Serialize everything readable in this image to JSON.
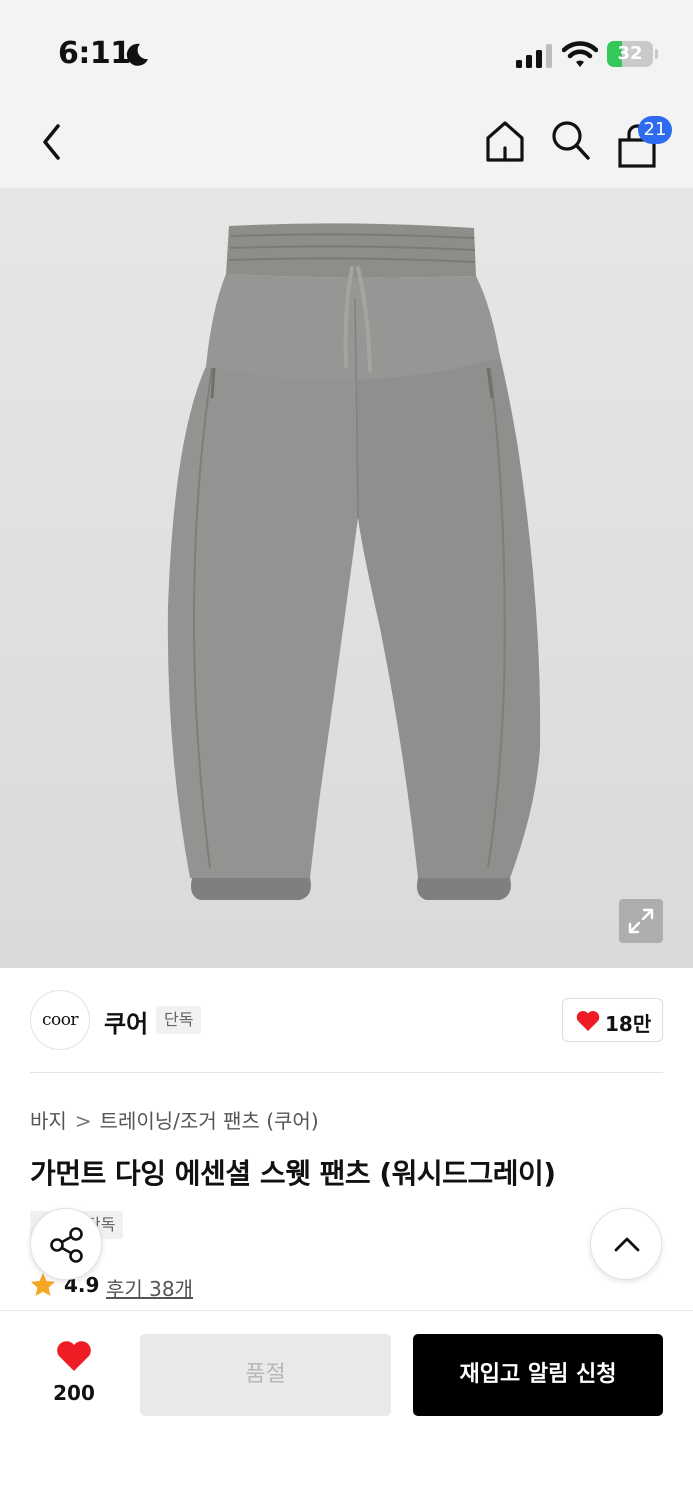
{
  "status_bar": {
    "time": "6:11",
    "battery_level": "32",
    "battery_fraction": 0.32
  },
  "nav": {
    "cart_count": "21"
  },
  "brand": {
    "logo_text": "coor",
    "name": "쿠어",
    "tag": "단독",
    "likes": "18만"
  },
  "product": {
    "breadcrumb": [
      "바지",
      "트레이닝/조거 팬츠 (쿠어)"
    ],
    "breadcrumb_separator": ">",
    "title": "가먼트 다잉 에센셜 스웻 팬츠 (워시드그레이)",
    "exclusive_tag": "단독",
    "rating": "4.9",
    "review_link": "후기 38개"
  },
  "bottom_bar": {
    "wish_count": "200",
    "soldout_label": "품절",
    "restock_label": "재입고 알림 신청"
  },
  "colors": {
    "accent_blue": "#2f6bf0",
    "heart_red": "#ee1c25",
    "star_orange": "#f5a623",
    "battery_green": "#34c759"
  }
}
